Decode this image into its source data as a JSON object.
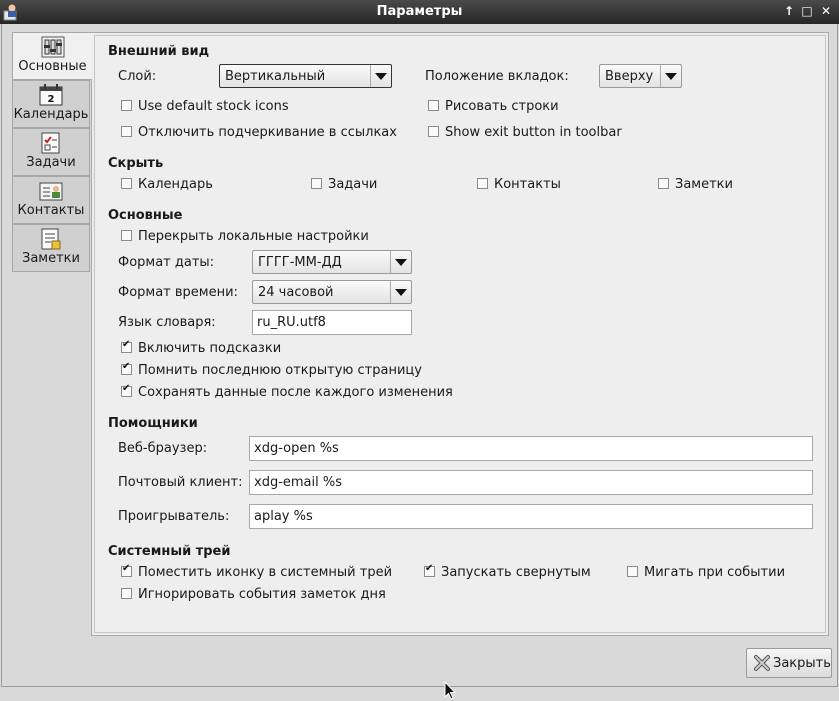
{
  "window": {
    "title": "Параметры",
    "controls": [
      "↑",
      "□",
      "✕"
    ]
  },
  "tabs": [
    {
      "label": "Основные",
      "icon": "settings-icon",
      "active": true
    },
    {
      "label": "Календарь",
      "icon": "calendar-icon",
      "day": "2"
    },
    {
      "label": "Задачи",
      "icon": "tasks-icon"
    },
    {
      "label": "Контакты",
      "icon": "contacts-icon"
    },
    {
      "label": "Заметки",
      "icon": "notes-icon"
    }
  ],
  "appearance": {
    "heading": "Внешний вид",
    "layer_label": "Слой:",
    "layer_value": "Вертикальный",
    "tab_position_label": "Положение вкладок:",
    "tab_position_value": "Вверху",
    "stock_icons": "Use default stock icons",
    "draw_rows": "Рисовать строки",
    "disable_underline": "Отключить подчеркивание в ссылках",
    "exit_button": "Show exit button in toolbar"
  },
  "hide": {
    "heading": "Скрыть",
    "calendar": "Календарь",
    "tasks": "Задачи",
    "contacts": "Контакты",
    "notes": "Заметки"
  },
  "general": {
    "heading": "Основные",
    "override_locale": "Перекрыть локальные настройки",
    "date_format_label": "Формат даты:",
    "date_format_value": "ГГГГ-ММ-ДД",
    "time_format_label": "Формат времени:",
    "time_format_value": "24 часовой",
    "dict_lang_label": "Язык словаря:",
    "dict_lang_value": "ru_RU.utf8",
    "enable_hints": "Включить подсказки",
    "remember_page": "Помнить последнюю открытую страницу",
    "save_after_change": "Сохранять данные после каждого изменения"
  },
  "helpers": {
    "heading": "Помощники",
    "browser_label": "Веб-браузер:",
    "browser_value": "xdg-open %s",
    "mail_label": "Почтовый клиент:",
    "mail_value": "xdg-email %s",
    "player_label": "Проигрыватель:",
    "player_value": "aplay %s"
  },
  "tray": {
    "heading": "Системный трей",
    "tray_icon": "Поместить иконку в системный трей",
    "start_minimized": "Запускать свернутым",
    "blink_on_event": "Мигать при событии",
    "ignore_day_notes": "Игнорировать события заметок дня"
  },
  "footer": {
    "close_label": "Закрыть"
  }
}
